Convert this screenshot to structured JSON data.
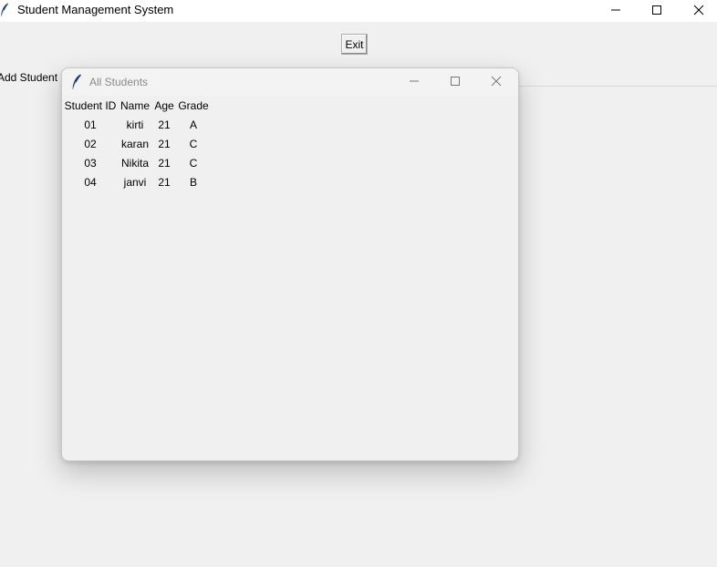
{
  "main_window": {
    "title": "Student Management System",
    "icon": "feather-icon"
  },
  "exit_button": {
    "label": "Exit"
  },
  "tabs": [
    {
      "label": "Add Student"
    }
  ],
  "all_students_window": {
    "title": "All Students",
    "icon": "feather-icon",
    "table": {
      "headers": [
        "Student ID",
        "Name",
        "Age",
        "Grade"
      ],
      "rows": [
        [
          "01",
          "kirti",
          "21",
          "A"
        ],
        [
          "02",
          "karan",
          "21",
          "C"
        ],
        [
          "03",
          "Nikita",
          "21",
          "C"
        ],
        [
          "04",
          "janvi",
          "21",
          "B"
        ]
      ]
    }
  }
}
